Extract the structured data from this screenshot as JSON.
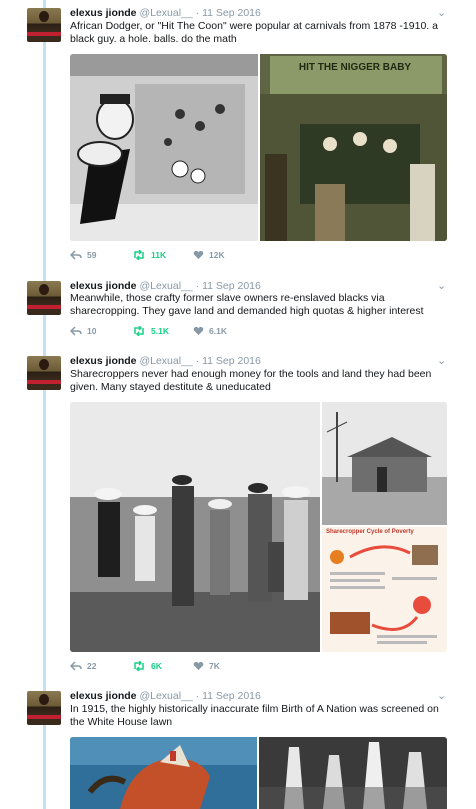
{
  "thread": {
    "tweets": [
      {
        "name": "elexus jionde",
        "handle": "@Lexual__",
        "date": "11 Sep 2016",
        "text": "African Dodger, or \"Hit The Coon\" were popular at carnivals from 1878 -1910. a black guy. a hole. balls. do the math",
        "replies": "59",
        "retweets": "11K",
        "likes": "12K",
        "media_caption": "HIT THE NIGGER BABY"
      },
      {
        "name": "elexus jionde",
        "handle": "@Lexual__",
        "date": "11 Sep 2016",
        "text": "Meanwhile, those crafty former slave owners re-enslaved blacks via sharecropping. They gave land and demanded high quotas & higher interest",
        "replies": "10",
        "retweets": "5.1K",
        "likes": "6.1K"
      },
      {
        "name": "elexus jionde",
        "handle": "@Lexual__",
        "date": "11 Sep 2016",
        "text": "Sharecroppers never had enough money for the tools and land they had been given. Many stayed destitute & uneducated",
        "replies": "22",
        "retweets": "6K",
        "likes": "7K",
        "infographic_title": "Sharecropper Cycle of Poverty"
      },
      {
        "name": "elexus jionde",
        "handle": "@Lexual__",
        "date": "11 Sep 2016",
        "text": "In 1915, the highly historically inaccurate film Birth of A Nation was screened on the White House lawn"
      }
    ]
  },
  "colors": {
    "thread_line": "#c4e0f5",
    "retweet": "#19cf86",
    "meta": "#8899a6"
  },
  "icons": [
    "reply-icon",
    "retweet-icon",
    "heart-icon",
    "caret-down-icon"
  ]
}
